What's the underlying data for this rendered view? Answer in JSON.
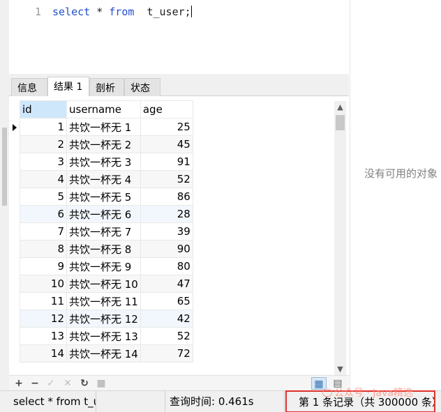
{
  "editor": {
    "line_number": "1",
    "code": {
      "kw1": "select",
      "mid1": " * ",
      "kw2": "from",
      "rest": "  t_user;"
    }
  },
  "tabs": [
    {
      "label": "信息",
      "active": false
    },
    {
      "label": "结果 1",
      "active": true
    },
    {
      "label": "剖析",
      "active": false
    },
    {
      "label": "状态",
      "active": false
    }
  ],
  "grid": {
    "columns": [
      "id",
      "username",
      "age"
    ],
    "rows": [
      {
        "id": "1",
        "username": "共饮一杯无 1",
        "age": "25"
      },
      {
        "id": "2",
        "username": "共饮一杯无 2",
        "age": "45"
      },
      {
        "id": "3",
        "username": "共饮一杯无 3",
        "age": "91"
      },
      {
        "id": "4",
        "username": "共饮一杯无 4",
        "age": "52"
      },
      {
        "id": "5",
        "username": "共饮一杯无 5",
        "age": "86"
      },
      {
        "id": "6",
        "username": "共饮一杯无 6",
        "age": "28"
      },
      {
        "id": "7",
        "username": "共饮一杯无 7",
        "age": "39"
      },
      {
        "id": "8",
        "username": "共饮一杯无 8",
        "age": "90"
      },
      {
        "id": "9",
        "username": "共饮一杯无 9",
        "age": "80"
      },
      {
        "id": "10",
        "username": "共饮一杯无 10",
        "age": "47"
      },
      {
        "id": "11",
        "username": "共饮一杯无 11",
        "age": "65"
      },
      {
        "id": "12",
        "username": "共饮一杯无 12",
        "age": "42"
      },
      {
        "id": "13",
        "username": "共饮一杯无 13",
        "age": "52"
      },
      {
        "id": "14",
        "username": "共饮一杯无 14",
        "age": "72"
      }
    ]
  },
  "right_panel": {
    "empty_text": "没有可用的对象"
  },
  "toolbar": {
    "add": "+",
    "remove": "−",
    "apply": "✓",
    "cancel": "✕",
    "refresh": "↻",
    "stop": "■"
  },
  "status": {
    "sql": "select * from t_user;",
    "query_time": "查询时间: 0.461s",
    "record_count": "第 1 条记录（共 300000 条）"
  },
  "watermark": "公众号 · Java精选"
}
